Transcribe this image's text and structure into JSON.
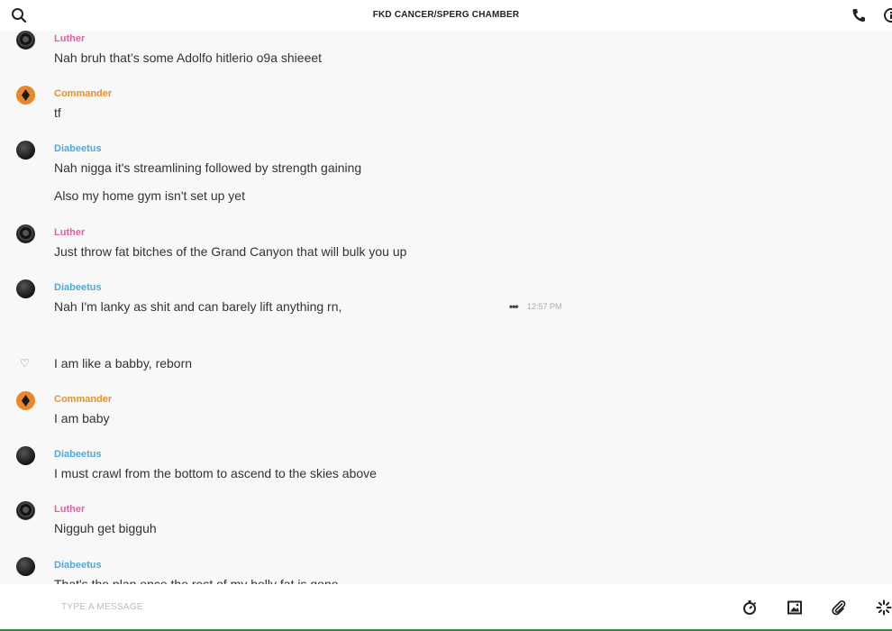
{
  "header": {
    "title": "FKD CANCER/SPERG CHAMBER",
    "icons": [
      "search-icon",
      "phone-icon",
      "info-icon"
    ]
  },
  "messages": [
    {
      "author": "Luther",
      "avatar": "luther",
      "lines": [
        "Nah bruh that’s some Adolfo hitlerio o9a shieeet"
      ]
    },
    {
      "author": "Commander",
      "avatar": "commander",
      "lines": [
        "tf"
      ]
    },
    {
      "author": "Diabeetus",
      "avatar": "diabeetus",
      "lines": [
        "Nah nigga it's streamlining followed by strength gaining",
        "Also my home gym isn't set up yet"
      ]
    },
    {
      "author": "Luther",
      "avatar": "luther",
      "lines": [
        "Just throw fat bitches of the Grand Canyon that will bulk you up"
      ]
    },
    {
      "author": "Diabeetus",
      "avatar": "diabeetus",
      "lines": [
        "Nah I'm lanky as shit and can barely lift anything rn,"
      ],
      "hover_time": "12:57 PM",
      "hover_menu": "•••"
    },
    {
      "author": "",
      "avatar": "heart",
      "lines": [
        "I am like a babby, reborn"
      ],
      "heart_glyph": "♡"
    },
    {
      "author": "Commander",
      "avatar": "commander",
      "lines": [
        "I am baby"
      ]
    },
    {
      "author": "Diabeetus",
      "avatar": "diabeetus",
      "lines": [
        "I must crawl from the bottom to ascend to the skies above"
      ]
    },
    {
      "author": "Luther",
      "avatar": "luther",
      "lines": [
        "Nigguh get bigguh"
      ]
    },
    {
      "author": "Diabeetus",
      "avatar": "diabeetus",
      "lines": [
        "That's the plan once the rest of my belly fat is gone"
      ]
    }
  ],
  "composer": {
    "placeholder": "TYPE A MESSAGE",
    "icons": [
      "stopwatch-icon",
      "image-icon",
      "paperclip-icon",
      "sparkle-icon"
    ]
  },
  "colors": {
    "luther": "#e25fa4",
    "commander": "#e8902a",
    "diabeetus": "#4fa9d8",
    "accent_border": "#2c8c3c"
  }
}
